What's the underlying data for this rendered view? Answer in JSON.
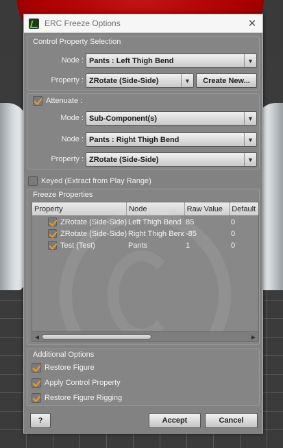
{
  "window": {
    "title": "ERC Freeze Options",
    "close_glyph": "✕",
    "icon": "daz-app-icon"
  },
  "control_property_selection": {
    "title": "Control Property Selection",
    "node_label": "Node :",
    "node_value": "Pants : Left Thigh Bend",
    "property_label": "Property :",
    "property_value": "ZRotate (Side-Side)",
    "create_new_label": "Create New..."
  },
  "attenuate": {
    "label": "Attenuate :",
    "checked": true,
    "mode_label": "Mode :",
    "mode_value": "Sub-Component(s)",
    "node_label": "Node :",
    "node_value": "Pants : Right Thigh Bend",
    "property_label": "Property :",
    "property_value": "ZRotate (Side-Side)"
  },
  "keyed": {
    "label": "Keyed (Extract from Play Range)",
    "checked": false
  },
  "freeze_properties": {
    "title": "Freeze Properties",
    "columns": [
      "Property",
      "Node",
      "Raw Value",
      "Default"
    ],
    "rows": [
      {
        "checked": true,
        "property": "ZRotate (Side-Side)",
        "node": "Left Thigh Bend",
        "raw": "85",
        "default": "0"
      },
      {
        "checked": true,
        "property": "ZRotate (Side-Side)",
        "node": "Right Thigh Bend",
        "raw": "-85",
        "default": "0"
      },
      {
        "checked": true,
        "property": "Test (Test)",
        "node": "Pants",
        "raw": "1",
        "default": "0"
      }
    ],
    "scroll_left_glyph": "◀",
    "scroll_right_glyph": "▶"
  },
  "additional_options": {
    "title": "Additional Options",
    "items": [
      {
        "label": "Restore Figure",
        "checked": true
      },
      {
        "label": "Apply Control Property",
        "checked": true
      },
      {
        "label": "Restore Figure Rigging",
        "checked": true
      }
    ]
  },
  "footer": {
    "help_label": "?",
    "accept_label": "Accept",
    "cancel_label": "Cancel"
  },
  "colors": {
    "dialog_bg": "#828282",
    "checkmark": "#f29a1b",
    "background_red": "#b00000"
  }
}
